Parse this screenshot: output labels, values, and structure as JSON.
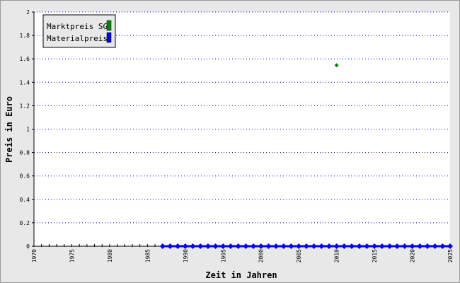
{
  "chart_data": {
    "type": "scatter",
    "title": "",
    "xlabel": "Zeit in Jahren",
    "ylabel": "Preis in Euro",
    "xlim": [
      1970,
      2025
    ],
    "ylim": [
      0,
      2
    ],
    "x_ticks": [
      "1970",
      "1975",
      "1980",
      "1985",
      "1990",
      "1995",
      "2000",
      "2005",
      "2010",
      "2015",
      "2020",
      "2025"
    ],
    "y_ticks": [
      "0",
      "0.2",
      "0.4",
      "0.6",
      "0.8",
      "1",
      "1.2",
      "1.4",
      "1.6",
      "1.8",
      "2"
    ],
    "grid": true,
    "legend_position": "top-left",
    "series": [
      {
        "name": "Marktpreis SG",
        "color": "#008800",
        "x": [
          2010
        ],
        "y": [
          1.545
        ]
      },
      {
        "name": "Materialpreis",
        "color": "#0000ff",
        "x": [
          1987,
          1988,
          1989,
          1990,
          1991,
          1992,
          1993,
          1994,
          1995,
          1996,
          1997,
          1998,
          1999,
          2000,
          2001,
          2002,
          2003,
          2004,
          2005,
          2006,
          2007,
          2008,
          2009,
          2010,
          2011,
          2012,
          2013,
          2014,
          2015,
          2016,
          2017,
          2018,
          2019,
          2020,
          2021,
          2022,
          2023,
          2024,
          2025
        ],
        "y": [
          0,
          0,
          0,
          0,
          0,
          0,
          0,
          0,
          0,
          0,
          0,
          0,
          0,
          0,
          0,
          0,
          0,
          0,
          0,
          0,
          0,
          0,
          0,
          0,
          0,
          0,
          0,
          0,
          0,
          0,
          0,
          0,
          0,
          0,
          0,
          0,
          0,
          0,
          0
        ]
      }
    ]
  }
}
